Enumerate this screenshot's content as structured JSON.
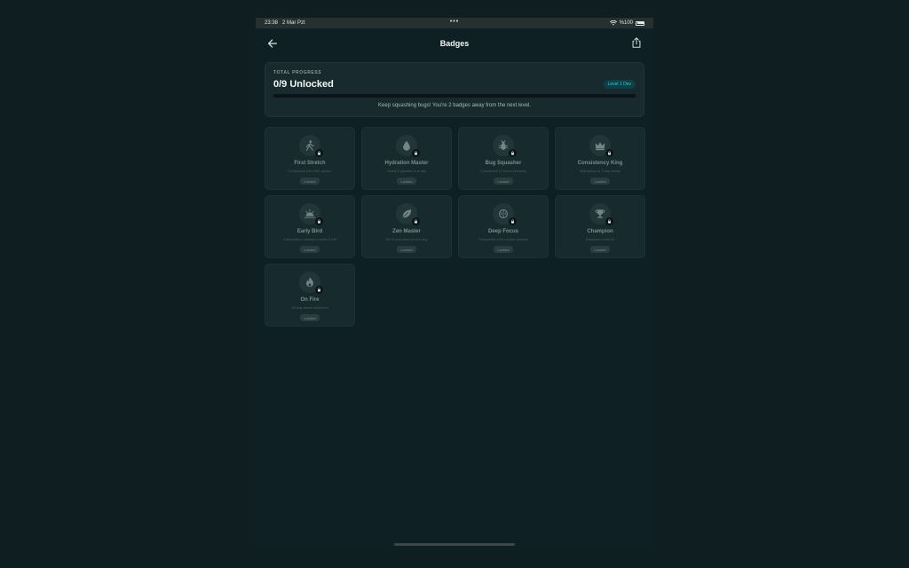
{
  "status": {
    "time": "23:38",
    "date": "2 Mar Pzt",
    "dots": "•••",
    "battery": "%100"
  },
  "nav": {
    "title": "Badges"
  },
  "progress": {
    "kicker": "TOTAL PROGRESS",
    "title": "0/9 Unlocked",
    "level": "Level 1 Dev",
    "fraction": 0,
    "message": "Keep squashing bugs! You're 2 badges away from the next level."
  },
  "badges": [
    {
      "name": "First Stretch",
      "desc": "Completed your first stretch",
      "status": "Locked",
      "icon": "walking-person-icon"
    },
    {
      "name": "Hydration Master",
      "desc": "Drank 8 glasses in a day",
      "status": "Locked",
      "icon": "water-drop-icon"
    },
    {
      "name": "Bug Squasher",
      "desc": "Completed 10 focus sessions",
      "status": "Locked",
      "icon": "bug-icon"
    },
    {
      "name": "Consistency King",
      "desc": "Maintained a 7-day streak",
      "status": "Locked",
      "icon": "crown-icon"
    },
    {
      "name": "Early Bird",
      "desc": "Completed a session before 9 AM",
      "status": "Locked",
      "icon": "sunrise-icon"
    },
    {
      "name": "Zen Master",
      "desc": "Did 5 exercises in one day",
      "status": "Locked",
      "icon": "leaf-icon"
    },
    {
      "name": "Deep Focus",
      "desc": "Completed a 60-minute session",
      "status": "Locked",
      "icon": "brain-icon"
    },
    {
      "name": "Champion",
      "desc": "Reached Level 10",
      "status": "Locked",
      "icon": "trophy-icon"
    },
    {
      "name": "On Fire",
      "desc": "30-day streak achieved",
      "status": "Locked",
      "icon": "flame-icon"
    }
  ],
  "colors": {
    "accent": "#35c9d6",
    "background": "#0f2024",
    "card": "#182a2d"
  }
}
